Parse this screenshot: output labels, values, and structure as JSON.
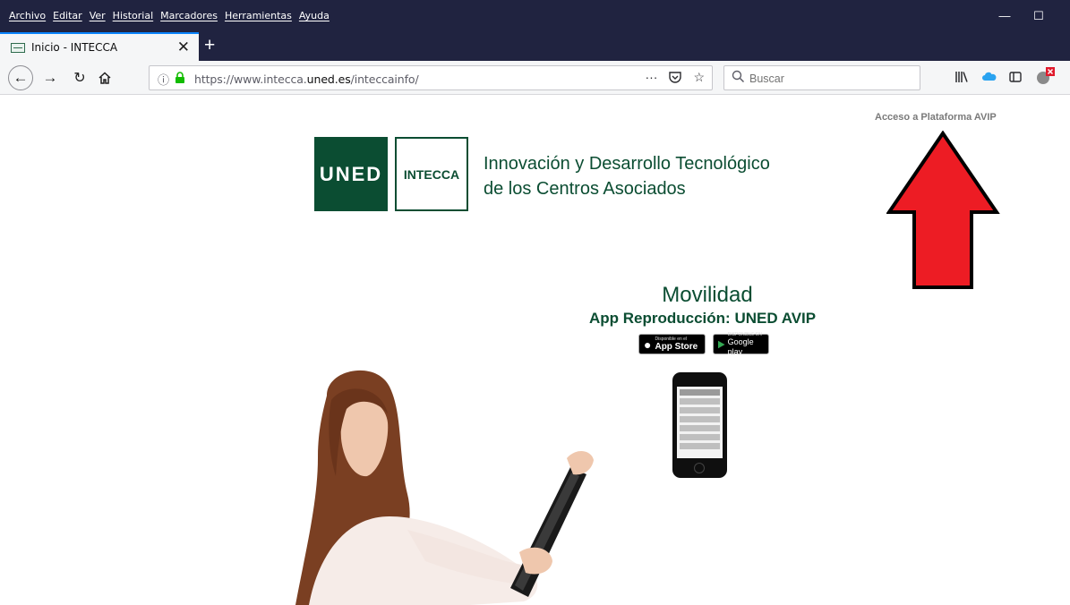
{
  "menu": [
    "Archivo",
    "Editar",
    "Ver",
    "Historial",
    "Marcadores",
    "Herramientas",
    "Ayuda"
  ],
  "window_controls": {
    "minimize": "—",
    "maximize": "☐"
  },
  "tab": {
    "title": "Inicio - INTECCA",
    "close": "✕"
  },
  "new_tab": "+",
  "url": {
    "scheme": "https://www.intecca.",
    "domain": "uned.es",
    "path": "/inteccainfo/"
  },
  "search": {
    "placeholder": "Buscar"
  },
  "page": {
    "avip_link": "Acceso a Plataforma AVIP",
    "logo_uned": "UNED",
    "logo_intecca": "INTECCA",
    "tagline_line1": "Innovación y Desarrollo Tecnológico",
    "tagline_line2": "de los Centros Asociados",
    "movilidad": "Movilidad",
    "app_label": "App Reproducción: UNED AVIP",
    "appstore_small": "Disponible en el",
    "appstore_big": "App Store",
    "gplay_small": "DISPONIBLE EN",
    "gplay_big": "Google play"
  },
  "colors": {
    "brand_green": "#0b4d32",
    "arrow_red": "#ed1c24",
    "chrome": "#202340"
  }
}
